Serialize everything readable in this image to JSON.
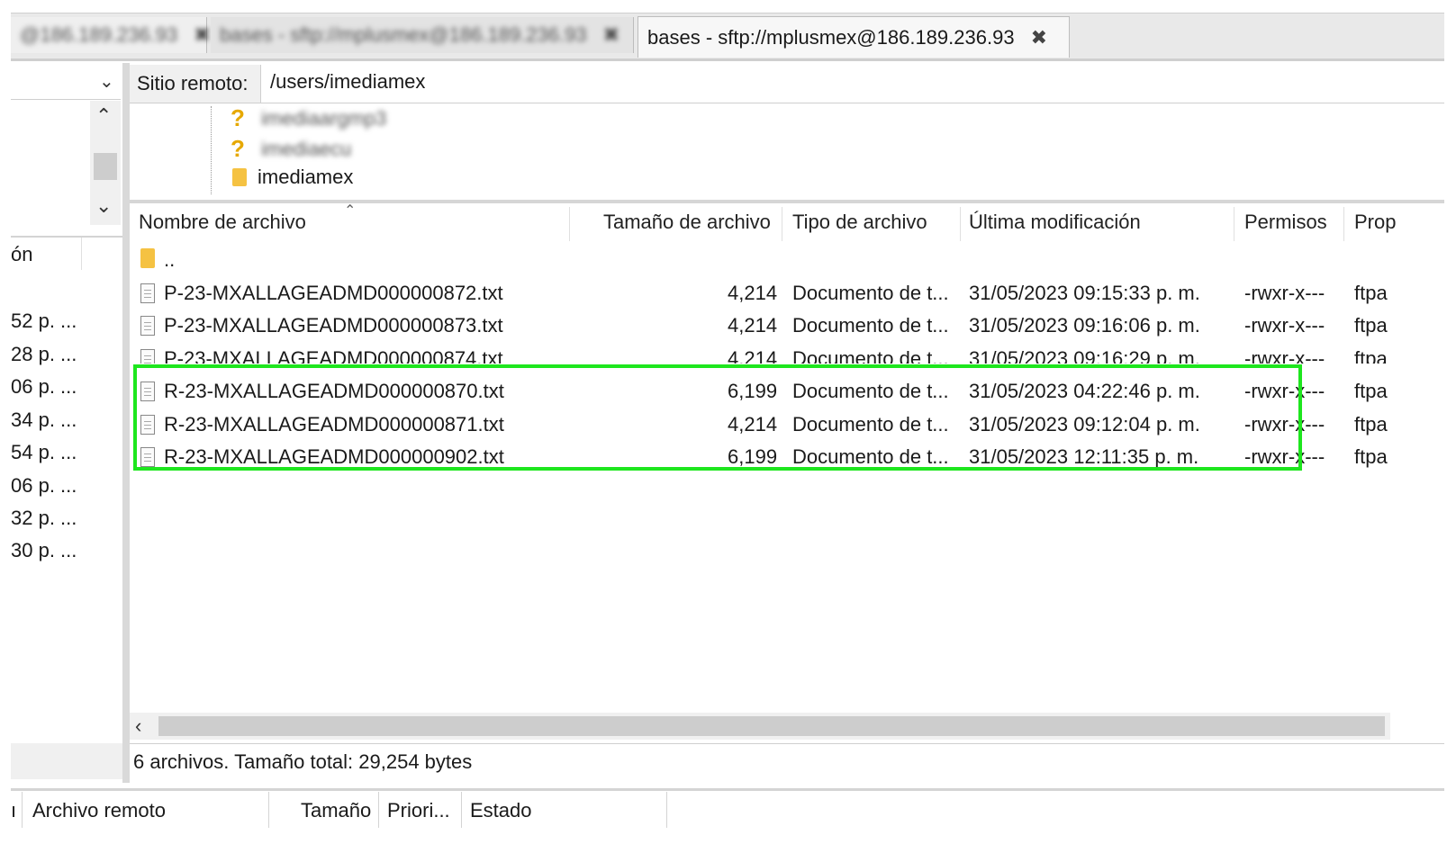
{
  "tabs": [
    {
      "label": "@186.189.236.93",
      "close": "✖"
    },
    {
      "label": "bases - sftp://mplusmex@186.189.236.93",
      "close": "✖"
    },
    {
      "label": "bases - sftp://mplusmex@186.189.236.93",
      "close": "✖"
    }
  ],
  "left_pane": {
    "header": "ón",
    "rows": [
      "52 p. ...",
      "28 p. ...",
      "06 p. ...",
      "34 p. ...",
      "54 p. ...",
      "06 p. ...",
      "32 p. ...",
      "30 p. ..."
    ]
  },
  "remote_site": {
    "label": "Sitio remoto:",
    "path": "/users/imediamex"
  },
  "tree": [
    {
      "name": "imediaargmp3",
      "icon": "question-folder-icon"
    },
    {
      "name": "imediaecu",
      "icon": "question-folder-icon"
    },
    {
      "name": "imediamex",
      "icon": "folder-icon"
    }
  ],
  "columns": {
    "name": "Nombre de archivo",
    "size": "Tamaño de archivo",
    "type": "Tipo de archivo",
    "modified": "Última modificación",
    "perms": "Permisos",
    "owner": "Prop"
  },
  "parent_dir": "..",
  "files": [
    {
      "name": "P-23-MXALLAGEADMD000000872.txt",
      "size": "4,214",
      "type": "Documento de t...",
      "modified": "31/05/2023 09:15:33 p. m.",
      "perms": "-rwxr-x---",
      "owner": "ftpa"
    },
    {
      "name": "P-23-MXALLAGEADMD000000873.txt",
      "size": "4,214",
      "type": "Documento de t...",
      "modified": "31/05/2023 09:16:06 p. m.",
      "perms": "-rwxr-x---",
      "owner": "ftpa"
    },
    {
      "name": "P-23-MXALLAGEADMD000000874.txt",
      "size": "4,214",
      "type": "Documento de t...",
      "modified": "31/05/2023 09:16:29 p. m.",
      "perms": "-rwxr-x---",
      "owner": "ftpa"
    },
    {
      "name": "R-23-MXALLAGEADMD000000870.txt",
      "size": "6,199",
      "type": "Documento de t...",
      "modified": "31/05/2023 04:22:46 p. m.",
      "perms": "-rwxr-x---",
      "owner": "ftpa"
    },
    {
      "name": "R-23-MXALLAGEADMD000000871.txt",
      "size": "4,214",
      "type": "Documento de t...",
      "modified": "31/05/2023 09:12:04 p. m.",
      "perms": "-rwxr-x---",
      "owner": "ftpa"
    },
    {
      "name": "R-23-MXALLAGEADMD000000902.txt",
      "size": "6,199",
      "type": "Documento de t...",
      "modified": "31/05/2023 12:11:35 p. m.",
      "perms": "-rwxr-x---",
      "owner": "ftpa"
    }
  ],
  "highlight_color": "#1ee61e",
  "status": "6 archivos. Tamaño total: 29,254 bytes",
  "queue": {
    "col0": "ı",
    "remote_file": "Archivo remoto",
    "size": "Tamaño",
    "priority": "Priori...",
    "state": "Estado"
  }
}
